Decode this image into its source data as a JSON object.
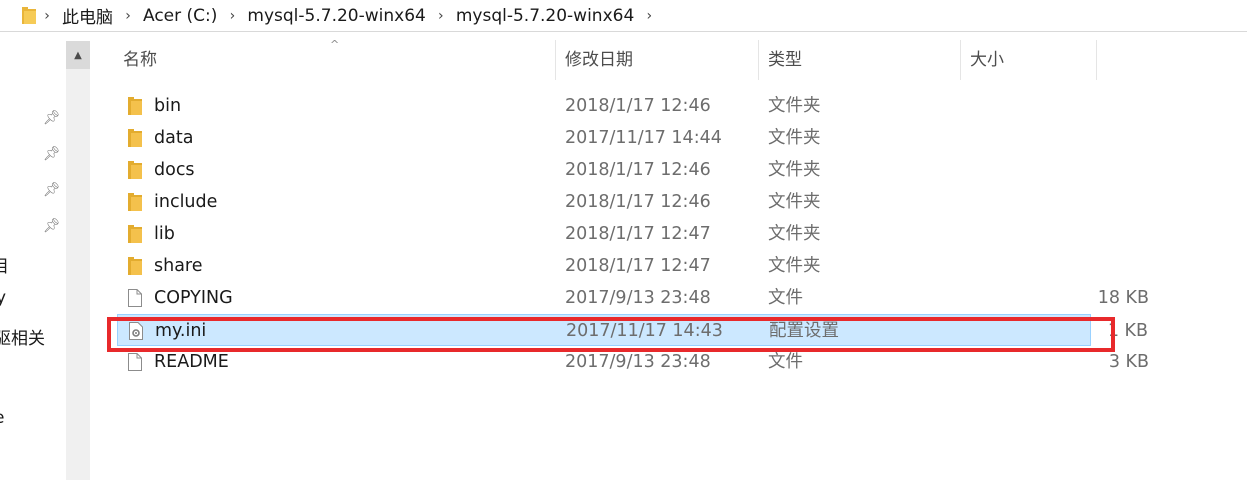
{
  "breadcrumb": [
    "此电脑",
    "Acer (C:)",
    "mysql-5.7.20-winx64",
    "mysql-5.7.20-winx64"
  ],
  "nav_cut_text": [
    "目",
    "y",
    "驱相关",
    "e"
  ],
  "columns": {
    "name": "名称",
    "date": "修改日期",
    "type": "类型",
    "size": "大小"
  },
  "files": [
    {
      "name": "bin",
      "date": "2018/1/17 12:46",
      "type": "文件夹",
      "size": "",
      "icon": "folder-icon"
    },
    {
      "name": "data",
      "date": "2017/11/17 14:44",
      "type": "文件夹",
      "size": "",
      "icon": "folder-icon"
    },
    {
      "name": "docs",
      "date": "2018/1/17 12:46",
      "type": "文件夹",
      "size": "",
      "icon": "folder-icon"
    },
    {
      "name": "include",
      "date": "2018/1/17 12:46",
      "type": "文件夹",
      "size": "",
      "icon": "folder-icon"
    },
    {
      "name": "lib",
      "date": "2018/1/17 12:47",
      "type": "文件夹",
      "size": "",
      "icon": "folder-icon"
    },
    {
      "name": "share",
      "date": "2018/1/17 12:47",
      "type": "文件夹",
      "size": "",
      "icon": "folder-icon"
    },
    {
      "name": "COPYING",
      "date": "2017/9/13 23:48",
      "type": "文件",
      "size": "18 KB",
      "icon": "file-icon"
    },
    {
      "name": "my.ini",
      "date": "2017/11/17 14:43",
      "type": "配置设置",
      "size": "1 KB",
      "icon": "settings-file-icon",
      "selected": true
    },
    {
      "name": "README",
      "date": "2017/9/13 23:48",
      "type": "文件",
      "size": "3 KB",
      "icon": "file-icon"
    }
  ],
  "colors": {
    "folder": "#f4c14c",
    "selection": "#cce8ff",
    "highlight": "#e8292b"
  }
}
